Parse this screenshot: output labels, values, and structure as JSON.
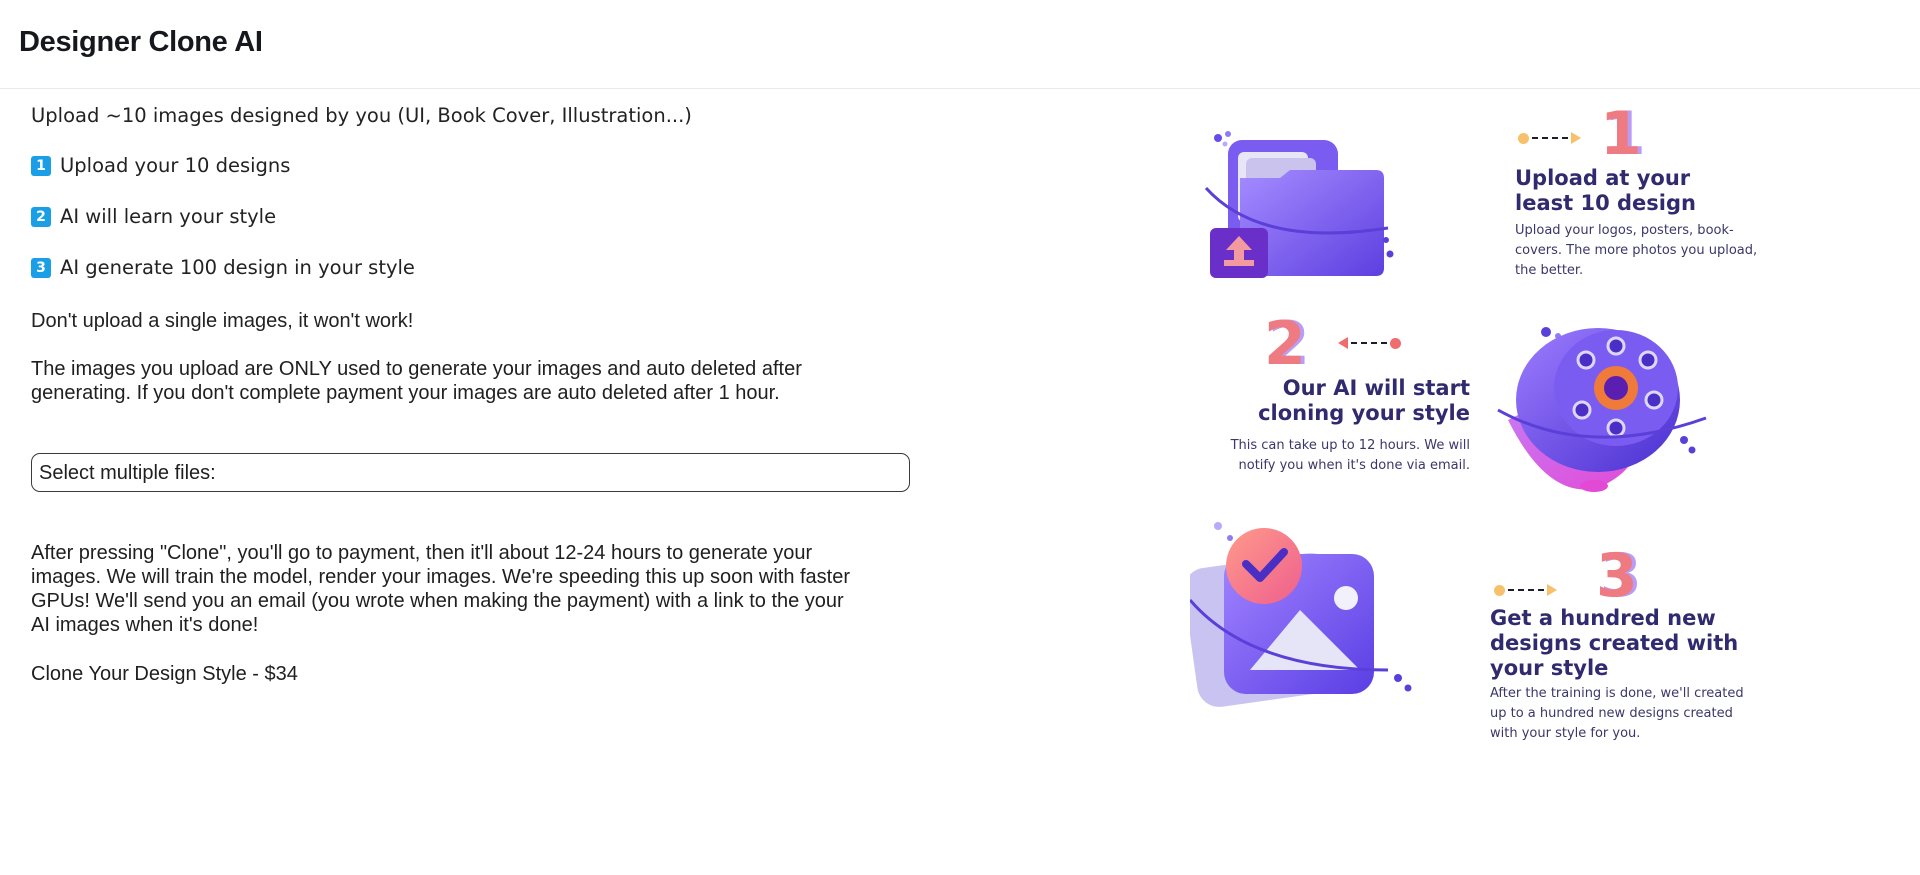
{
  "app": {
    "title": "Designer Clone AI"
  },
  "intro": {
    "upload_hint": "Upload ~10 images designed by you (UI, Book Cover, Illustration...)"
  },
  "steps": [
    {
      "badge": "1",
      "text": "Upload your 10 designs"
    },
    {
      "badge": "2",
      "text": "AI will learn your style"
    },
    {
      "badge": "3",
      "text": "AI generate 100 design in your style"
    }
  ],
  "warning": "Don't upload a single images, it won't work!",
  "privacy": {
    "line1": "The images you upload are ONLY used to generate your images and auto deleted after",
    "line2": "generating. If you don't complete payment your images are auto deleted after 1 hour."
  },
  "file_input": {
    "label": "Select multiple files:"
  },
  "after_clone": {
    "line1": "After pressing \"Clone\", you'll go to payment, then it'll about 12-24 hours to generate your",
    "line2": "images. We will train the model, render your images. We're speeding this up soon with faster",
    "line3": "GPUs! We'll send you an email (you wrote when making the payment) with a link to the your",
    "line4": "AI images when it's done!"
  },
  "price_line": "Clone Your Design Style - $34",
  "info_steps": [
    {
      "number": "1",
      "title_line1": "Upload at your",
      "title_line2": "least 10 design",
      "desc_line1": "Upload your logos, posters, book-",
      "desc_line2": "covers. The more photos you upload,",
      "desc_line3": "the better."
    },
    {
      "number": "2",
      "title_line1": "Our AI will start",
      "title_line2": "cloning your style",
      "desc_line1": "This can take up to 12 hours. We will",
      "desc_line2": "notify you when it's done via email."
    },
    {
      "number": "3",
      "title_line1": "Get a hundred new",
      "title_line2": "designs created with",
      "title_line3": "your style",
      "desc_line1": "After the training is done, we'll created",
      "desc_line2": "up to a hundred new designs created",
      "desc_line3": "with your style for you."
    }
  ],
  "colors": {
    "badge": "#1a9fe6",
    "accent_purple": "#7b5cf0",
    "number_pink": "#ee7b82",
    "title_navy": "#302a6e"
  },
  "icons": [
    "folder-upload-illustration",
    "gear-illustration",
    "image-check-illustration"
  ]
}
